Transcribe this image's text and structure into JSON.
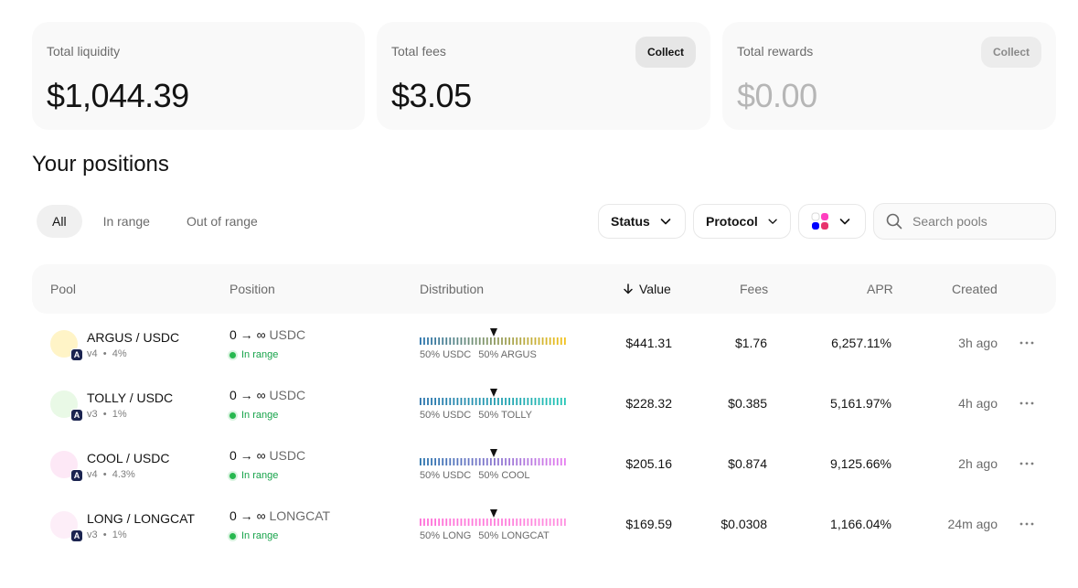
{
  "summary": {
    "liquidity": {
      "label": "Total liquidity",
      "value": "$1,044.39"
    },
    "fees": {
      "label": "Total fees",
      "value": "$3.05",
      "button": "Collect"
    },
    "rewards": {
      "label": "Total rewards",
      "value": "$0.00",
      "button": "Collect"
    }
  },
  "positions": {
    "title": "Your positions",
    "tabs": [
      {
        "label": "All",
        "active": true
      },
      {
        "label": "In range",
        "active": false
      },
      {
        "label": "Out of range",
        "active": false
      }
    ],
    "filters": {
      "status": "Status",
      "protocol": "Protocol",
      "network_icon": "networks-grid-icon"
    },
    "search": {
      "placeholder": "Search pools"
    },
    "columns": {
      "pool": "Pool",
      "position": "Position",
      "distribution": "Distribution",
      "value": "Value",
      "fees": "Fees",
      "apr": "APR",
      "created": "Created"
    },
    "rows": [
      {
        "pair": "ARGUS / USDC",
        "version": "v4",
        "fee": "4%",
        "badge": "A",
        "range": "0 → ∞",
        "range_unit": "USDC",
        "status": "In range",
        "dist_left": "50% USDC",
        "dist_right": "50% ARGUS",
        "value": "$441.31",
        "fees": "$1.76",
        "apr": "6,257.11%",
        "created": "3h ago",
        "colors": {
          "icon": "#fff4c7",
          "left": "#2a74ad",
          "right": "#f2c11b"
        }
      },
      {
        "pair": "TOLLY / USDC",
        "version": "v3",
        "fee": "1%",
        "badge": "A",
        "range": "0 → ∞",
        "range_unit": "USDC",
        "status": "In range",
        "dist_left": "50% USDC",
        "dist_right": "50% TOLLY",
        "value": "$228.32",
        "fees": "$0.385",
        "apr": "5,161.97%",
        "created": "4h ago",
        "colors": {
          "icon": "#e9f9e6",
          "left": "#2a74ad",
          "right": "#22c5b5"
        }
      },
      {
        "pair": "COOL / USDC",
        "version": "v4",
        "fee": "4.3%",
        "badge": "A",
        "range": "0 → ∞",
        "range_unit": "USDC",
        "status": "In range",
        "dist_left": "50% USDC",
        "dist_right": "50% COOL",
        "value": "$205.16",
        "fees": "$0.874",
        "apr": "9,125.66%",
        "created": "2h ago",
        "colors": {
          "icon": "#fde8f6",
          "left": "#2a74ad",
          "right": "#e67cf0"
        }
      },
      {
        "pair": "LONG / LONGCAT",
        "version": "v3",
        "fee": "1%",
        "badge": "A",
        "range": "0 → ∞",
        "range_unit": "LONGCAT",
        "status": "In range",
        "dist_left": "50% LONG",
        "dist_right": "50% LONGCAT",
        "value": "$169.59",
        "fees": "$0.0308",
        "apr": "1,166.04%",
        "created": "24m ago",
        "colors": {
          "icon": "#fdeef8",
          "left": "#ff6fd8",
          "right": "#ff8fe0"
        }
      }
    ]
  }
}
